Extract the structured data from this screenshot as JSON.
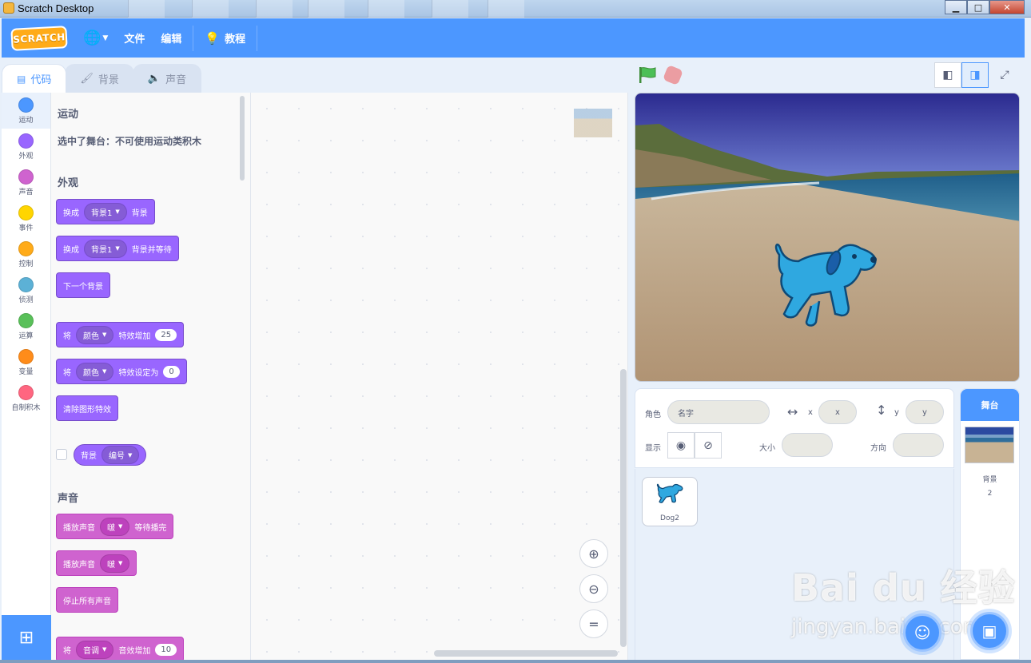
{
  "window": {
    "title": "Scratch Desktop"
  },
  "menubar": {
    "logo": "SCRATCH",
    "file": "文件",
    "edit": "编辑",
    "tutorials": "教程"
  },
  "tabs": [
    {
      "label": "代码",
      "icon": "code-icon"
    },
    {
      "label": "背景",
      "icon": "brush-icon"
    },
    {
      "label": "声音",
      "icon": "speaker-icon"
    }
  ],
  "categories": [
    {
      "label": "运动",
      "color": "#4c97ff"
    },
    {
      "label": "外观",
      "color": "#9966ff"
    },
    {
      "label": "声音",
      "color": "#cf63cf"
    },
    {
      "label": "事件",
      "color": "#ffd500"
    },
    {
      "label": "控制",
      "color": "#ffab19"
    },
    {
      "label": "侦测",
      "color": "#5cb1d6"
    },
    {
      "label": "运算",
      "color": "#59c059"
    },
    {
      "label": "变量",
      "color": "#ff8c1a"
    },
    {
      "label": "自制积木",
      "color": "#ff6680"
    }
  ],
  "palette": {
    "motion_title": "运动",
    "motion_notice": "选中了舞台：不可使用运动类积木",
    "looks_title": "外观",
    "sound_title": "声音",
    "blocks": {
      "switch_backdrop": {
        "a": "换成",
        "dd": "背景1",
        "b": "背景"
      },
      "switch_backdrop_wait": {
        "a": "换成",
        "dd": "背景1",
        "b": "背景并等待"
      },
      "next_backdrop": "下一个背景",
      "change_effect": {
        "a": "将",
        "dd": "颜色",
        "b": "特效增加",
        "n": "25"
      },
      "set_effect": {
        "a": "将",
        "dd": "颜色",
        "b": "特效设定为",
        "n": "0"
      },
      "clear_effects": "清除图形特效",
      "backdrop_reporter": {
        "a": "背景",
        "dd": "编号"
      },
      "play_until_done": {
        "a": "播放声音",
        "dd": "啵",
        "b": "等待播完"
      },
      "start_sound": {
        "a": "播放声音",
        "dd": "啵"
      },
      "stop_all_sounds": "停止所有声音",
      "change_sound_effect": {
        "a": "将",
        "dd": "音调",
        "b": "音效增加",
        "n": "10"
      }
    }
  },
  "zoom": {
    "in": "+",
    "out": "−",
    "reset": "="
  },
  "sprite_info": {
    "sprite_label": "角色",
    "name_placeholder": "名字",
    "x_label": "x",
    "x_placeholder": "x",
    "y_label": "y",
    "y_placeholder": "y",
    "show_label": "显示",
    "size_label": "大小",
    "direction_label": "方向"
  },
  "sprites": [
    {
      "name": "Dog2"
    }
  ],
  "stage_pane": {
    "header": "舞台",
    "backdrops_label": "背景",
    "backdrops_count": "2"
  },
  "watermark": {
    "line1": "Bai du 经验",
    "line2": "jingyan.baidu.com"
  }
}
